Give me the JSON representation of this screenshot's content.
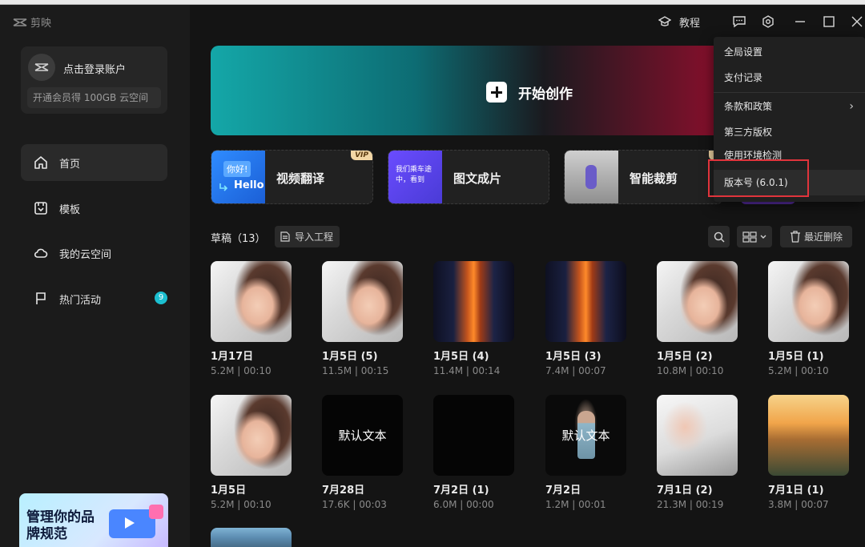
{
  "app": {
    "logo_text": "剪映"
  },
  "titlebar": {
    "tutorial_label": "教程"
  },
  "account": {
    "name": "点击登录账户",
    "vip_prompt": "开通会员得 100GB 云空间"
  },
  "nav": [
    {
      "label": "首页",
      "icon": "home-icon",
      "active": true
    },
    {
      "label": "模板",
      "icon": "template-icon",
      "active": false
    },
    {
      "label": "我的云空间",
      "icon": "cloud-icon",
      "active": false
    },
    {
      "label": "热门活动",
      "icon": "flag-icon",
      "active": false,
      "badge": "9"
    }
  ],
  "promo": {
    "text": "管理你的品牌规范"
  },
  "hero": {
    "label": "开始创作"
  },
  "tools": [
    {
      "label": "视频翻译",
      "vip": "VIP",
      "thumb_texts": [
        "你好!",
        "Hello"
      ]
    },
    {
      "label": "图文成片",
      "thumb_texts": [
        "我们乘车途中，看到"
      ]
    },
    {
      "label": "智能裁剪",
      "vip": "V"
    }
  ],
  "drafts": {
    "title": "草稿",
    "count": "（13）",
    "import_label": "导入工程",
    "recent_delete_label": "最近删除",
    "items": [
      {
        "title": "1月17日",
        "meta": "5.2M | 00:10",
        "thumb": "portrait"
      },
      {
        "title": "1月5日 (5)",
        "meta": "11.5M | 00:15",
        "thumb": "portrait"
      },
      {
        "title": "1月5日 (4)",
        "meta": "11.4M | 00:14",
        "thumb": "fire"
      },
      {
        "title": "1月5日 (3)",
        "meta": "7.4M | 00:07",
        "thumb": "fire"
      },
      {
        "title": "1月5日 (2)",
        "meta": "10.8M | 00:10",
        "thumb": "portrait"
      },
      {
        "title": "1月5日 (1)",
        "meta": "5.2M | 00:10",
        "thumb": "portrait"
      },
      {
        "title": "1月5日",
        "meta": "5.2M | 00:10",
        "thumb": "portrait"
      },
      {
        "title": "7月28日",
        "meta": "17.6K | 00:03",
        "thumb": "text",
        "thumb_text": "默认文本"
      },
      {
        "title": "7月2日 (1)",
        "meta": "6.0M | 00:00",
        "thumb": "black"
      },
      {
        "title": "7月2日",
        "meta": "1.2M | 00:01",
        "thumb": "presenter",
        "thumb_text": "默认文本"
      },
      {
        "title": "7月1日 (2)",
        "meta": "21.3M | 00:19",
        "thumb": "bed"
      },
      {
        "title": "7月1日 (1)",
        "meta": "3.8M | 00:07",
        "thumb": "car"
      }
    ]
  },
  "menu": {
    "items": [
      {
        "label": "全局设置"
      },
      {
        "label": "支付记录"
      },
      {
        "label": "条款和政策",
        "has_submenu": true
      },
      {
        "label": "第三方版权"
      },
      {
        "label": "使用环境检测"
      },
      {
        "label": "版本号 (6.0.1)",
        "highlighted": true
      }
    ]
  },
  "colors": {
    "accent": "#1cbfd0",
    "highlight_border": "#e0343c",
    "vip_tag": "#f2d6a5"
  }
}
